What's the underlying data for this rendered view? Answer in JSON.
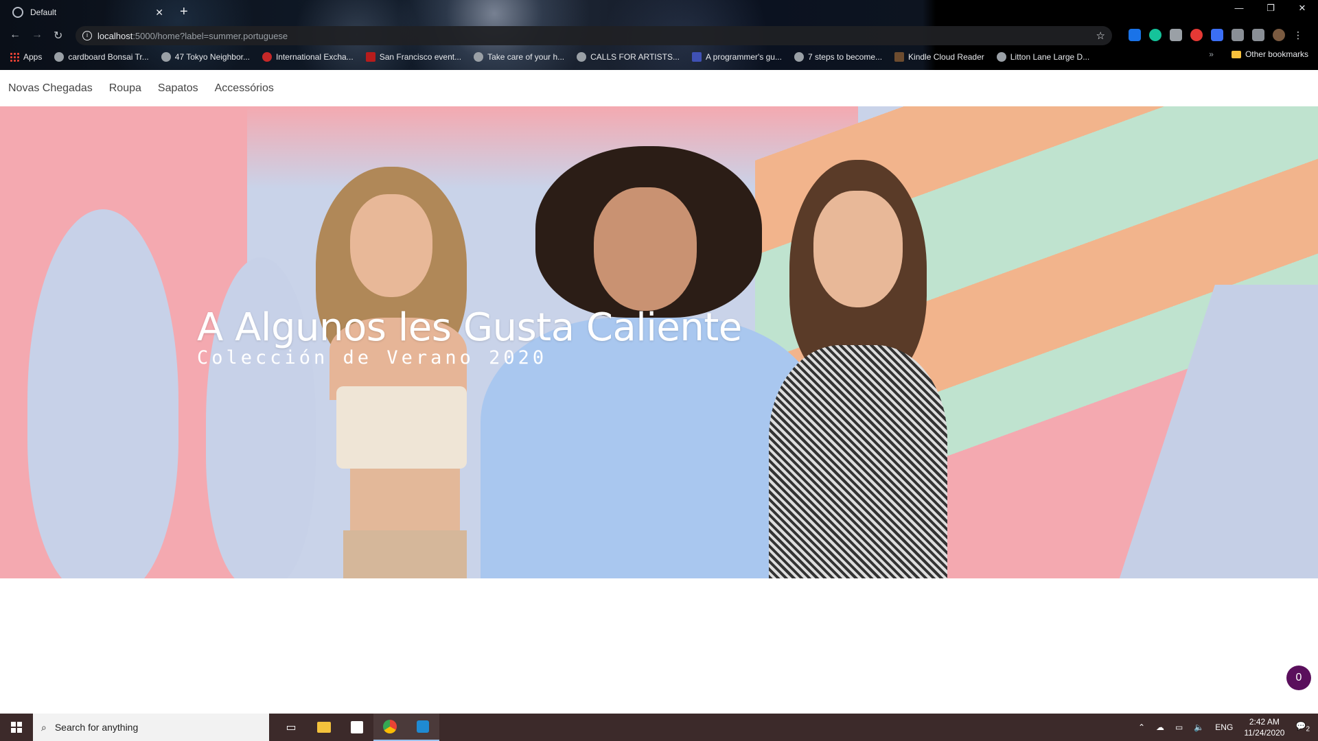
{
  "browser": {
    "tab_title": "Default",
    "url_host": "localhost",
    "url_path": ":5000/home?label=summer.portuguese",
    "bookmarks": [
      "Apps",
      "cardboard Bonsai Tr...",
      "47 Tokyo Neighbor...",
      "International Excha...",
      "San Francisco event...",
      "Take care of your h...",
      "CALLS FOR ARTISTS...",
      "A programmer's gu...",
      "7 steps to become...",
      "Kindle Cloud Reader",
      "Litton Lane Large D..."
    ],
    "other_bookmarks": "Other bookmarks"
  },
  "nav": {
    "items": [
      "Novas Chegadas",
      "Roupa",
      "Sapatos",
      "Accessórios"
    ]
  },
  "hero": {
    "title": "A Algunos les Gusta Caliente",
    "subtitle": "Colección de Verano 2020"
  },
  "cart": {
    "count": "0"
  },
  "taskbar": {
    "search_placeholder": "Search for anything",
    "lang": "ENG",
    "time": "2:42 AM",
    "date": "11/24/2020",
    "notifications": "2"
  },
  "colors": {
    "hero_pink": "#f4a9b0",
    "hero_blue": "#c9d3e9",
    "hero_peach": "#f2b48c",
    "hero_mint": "#bfe3cf",
    "cart_badge": "#5a0f5c"
  }
}
